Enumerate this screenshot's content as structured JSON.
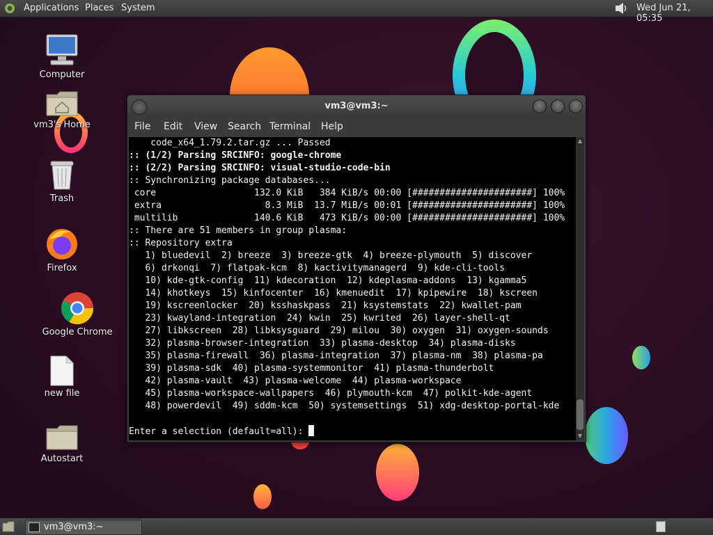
{
  "top_panel": {
    "menus": [
      "Applications",
      "Places",
      "System"
    ],
    "clock": "Wed Jun 21, 05:35"
  },
  "desktop_icons": [
    {
      "label": "Computer",
      "icon": "computer-icon"
    },
    {
      "label": "vm3's Home",
      "icon": "home-folder-icon"
    },
    {
      "label": "Trash",
      "icon": "trash-icon"
    },
    {
      "label": "Firefox",
      "icon": "firefox-icon"
    },
    {
      "label": "Google Chrome",
      "icon": "chrome-icon"
    },
    {
      "label": "new file",
      "icon": "file-icon"
    },
    {
      "label": "Autostart",
      "icon": "folder-icon"
    }
  ],
  "window": {
    "title": "vm3@vm3:~",
    "menu": [
      "File",
      "Edit",
      "View",
      "Search",
      "Terminal",
      "Help"
    ]
  },
  "terminal": {
    "lines": [
      "    code_x64_1.79.2.tar.gz ... Passed",
      ":: (1/2) Parsing SRCINFO: google-chrome",
      ":: (2/2) Parsing SRCINFO: visual-studio-code-bin",
      ":: Synchronizing package databases...",
      " core                  132.0 KiB   384 KiB/s 00:00 [######################] 100%",
      " extra                   8.3 MiB  13.7 MiB/s 00:01 [######################] 100%",
      " multilib              140.6 KiB   473 KiB/s 00:00 [######################] 100%",
      ":: There are 51 members in group plasma:",
      ":: Repository extra",
      "   1) bluedevil  2) breeze  3) breeze-gtk  4) breeze-plymouth  5) discover",
      "   6) drkonqi  7) flatpak-kcm  8) kactivitymanagerd  9) kde-cli-tools",
      "   10) kde-gtk-config  11) kdecoration  12) kdeplasma-addons  13) kgamma5",
      "   14) khotkeys  15) kinfocenter  16) kmenuedit  17) kpipewire  18) kscreen",
      "   19) kscreenlocker  20) ksshaskpass  21) ksystemstats  22) kwallet-pam",
      "   23) kwayland-integration  24) kwin  25) kwrited  26) layer-shell-qt",
      "   27) libkscreen  28) libksysguard  29) milou  30) oxygen  31) oxygen-sounds",
      "   32) plasma-browser-integration  33) plasma-desktop  34) plasma-disks",
      "   35) plasma-firewall  36) plasma-integration  37) plasma-nm  38) plasma-pa",
      "   39) plasma-sdk  40) plasma-systemmonitor  41) plasma-thunderbolt",
      "   42) plasma-vault  43) plasma-welcome  44) plasma-workspace",
      "   45) plasma-workspace-wallpapers  46) plymouth-kcm  47) polkit-kde-agent",
      "   48) powerdevil  49) sddm-kcm  50) systemsettings  51) xdg-desktop-portal-kde",
      "",
      "Enter a selection (default=all): "
    ],
    "bold_lines": [
      1,
      2
    ]
  },
  "bottom_panel": {
    "task_label": "vm3@vm3:~"
  }
}
